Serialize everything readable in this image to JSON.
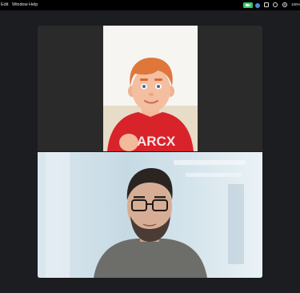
{
  "menubar": {
    "items": [
      "Edit",
      "Window",
      "Help"
    ],
    "battery_percent": "100%",
    "icons": [
      "camera-on-icon",
      "zoom-status-icon",
      "screen-share-icon",
      "stop-icon",
      "chat-icon",
      "accessibility-icon"
    ]
  },
  "call": {
    "participants": [
      {
        "kind": "memoji-avatar",
        "shirt_text": "MARCX"
      },
      {
        "kind": "camera-video"
      }
    ]
  },
  "colors": {
    "background": "#1c1d20",
    "camera_indicator": "#34c759",
    "avatar_shirt": "#d8232a",
    "avatar_hair": "#e0773a"
  }
}
